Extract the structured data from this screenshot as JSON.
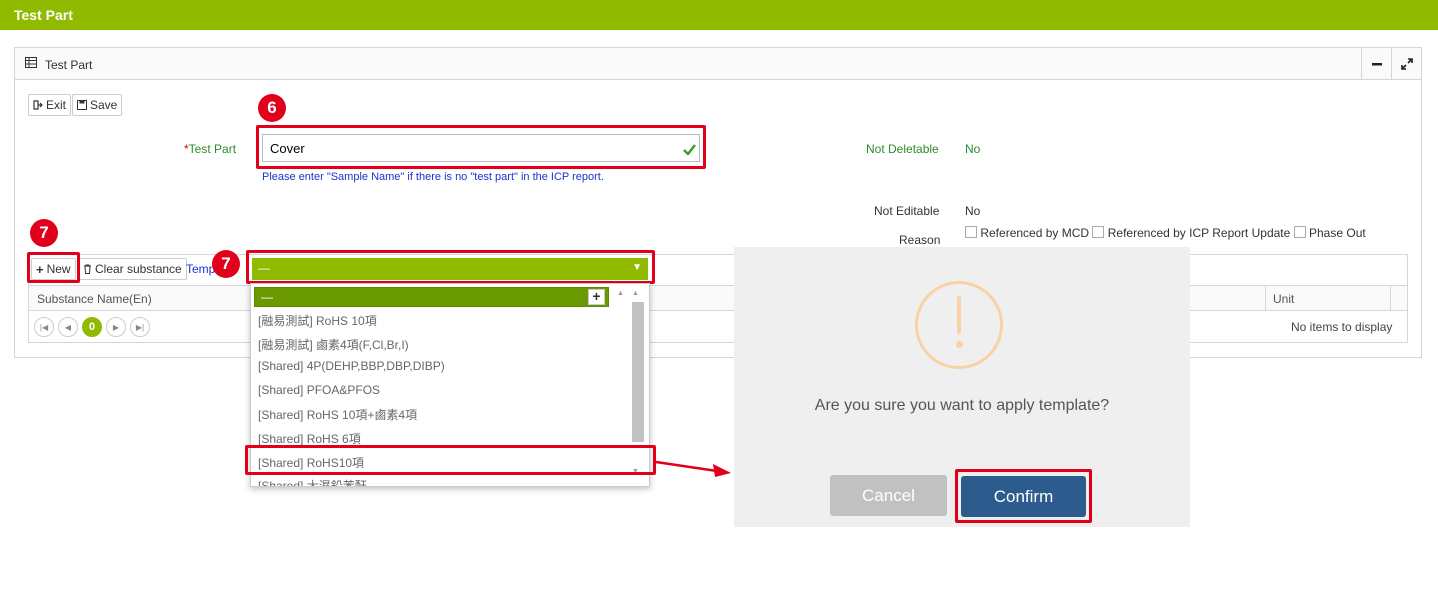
{
  "topbar": {
    "title": "Test Part"
  },
  "panel": {
    "title": "Test Part",
    "icon": "table-icon"
  },
  "toolbar": {
    "exit_label": "Exit",
    "save_label": "Save"
  },
  "form": {
    "test_part_label": "Test Part",
    "required_mark": "*",
    "test_part_value": "Cover",
    "hint": "Please enter \"Sample Name\" if there is no \"test part\" in the ICP report.",
    "not_deletable_label": "Not Deletable",
    "not_deletable_value": "No",
    "not_editable_label": "Not Editable",
    "not_editable_value": "No",
    "reason_label": "Reason",
    "reasons": [
      "Referenced by MCD",
      "Referenced by ICP Report Update",
      "Phase Out"
    ]
  },
  "annotations": {
    "step6": "6",
    "step7a": "7",
    "step7b": "7"
  },
  "grid": {
    "new_label": "New",
    "clear_label": "Clear substance",
    "template_label": "Temp",
    "columns": [
      "Substance Name(En)",
      "Unit"
    ],
    "page": "0",
    "empty_text": "No items to display"
  },
  "template_dropdown": {
    "selected": "—",
    "filter_value": "—",
    "items": [
      "[融易測試] RoHS 10項",
      "[融易測試] 鹵素4項(F,Cl,Br,I)",
      "[Shared] 4P(DEHP,BBP,DBP,DIBP)",
      "[Shared] PFOA&PFOS",
      "[Shared] RoHS 10項+鹵素4項",
      "[Shared] RoHS 6項",
      "[Shared] RoHS10項",
      "[Shared] 大濕鉛苯酐"
    ]
  },
  "dialog": {
    "message": "Are you sure you want to apply template?",
    "cancel_label": "Cancel",
    "confirm_label": "Confirm",
    "icon_color": "#f8d2a4"
  },
  "colors": {
    "brand": "#8fba00",
    "annotation": "#e0001b",
    "confirm": "#2c5b8e"
  }
}
